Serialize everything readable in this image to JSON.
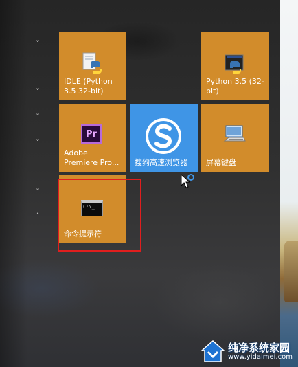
{
  "start_menu": {
    "groups": [
      {
        "toggle": "˅"
      },
      {
        "toggle": "˅"
      },
      {
        "toggle": "˅"
      },
      {
        "toggle": "˅"
      },
      {
        "toggle": "˅"
      },
      {
        "toggle": "˄"
      }
    ],
    "tiles": [
      {
        "label": "IDLE (Python 3.5 32-bit)",
        "icon": "python-idle-icon"
      },
      {
        "label": "Python 3.5 (32-bit)",
        "icon": "python-icon"
      },
      {
        "label": "Adobe Premiere Pro...",
        "icon": "premiere-pro-icon",
        "badge": "Pr"
      },
      {
        "label": "搜狗高速浏览器",
        "icon": "sogou-browser-icon"
      },
      {
        "label": "屏幕键盘",
        "icon": "on-screen-keyboard-icon"
      },
      {
        "label": "命令提示符",
        "icon": "command-prompt-icon",
        "glyph": "C:\\_"
      }
    ],
    "colors": {
      "tile_orange": "#d28c2b",
      "tile_blue": "#3f95e6",
      "highlight": "#e01e1e"
    }
  },
  "watermark": {
    "title": "纯净系统家园",
    "url": "www.yidaimei.com"
  }
}
